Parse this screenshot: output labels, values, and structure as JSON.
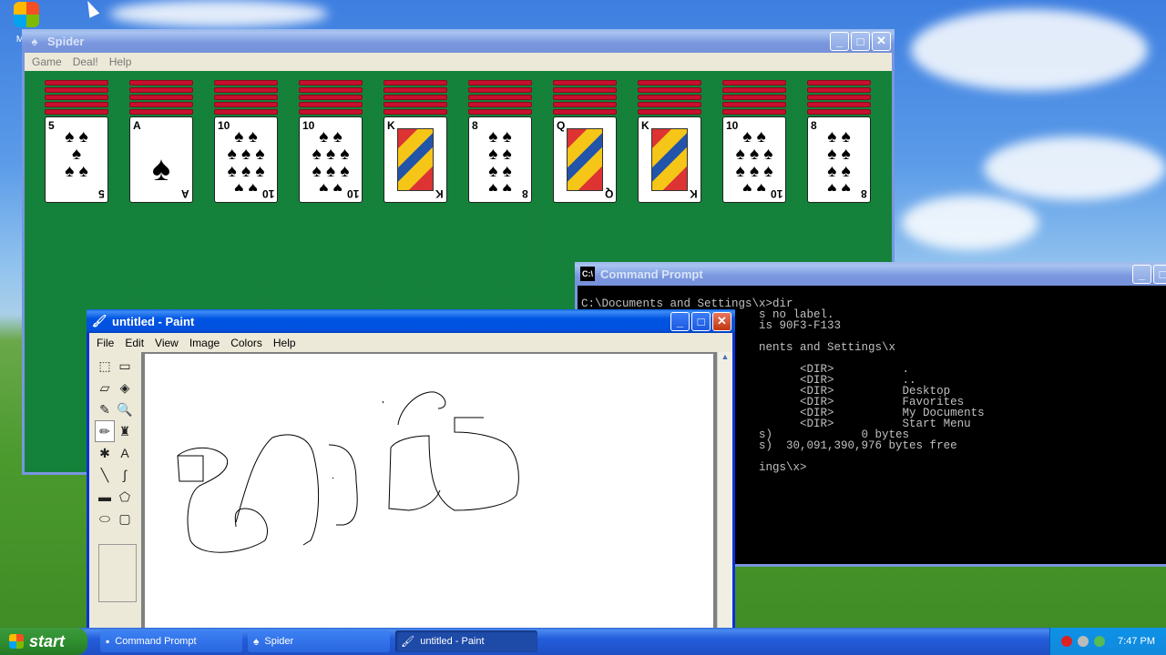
{
  "desktop": {
    "icon_label": "MSN"
  },
  "spider": {
    "title": "Spider",
    "menu": [
      "Game",
      "Deal!",
      "Help"
    ],
    "piles": [
      {
        "rank": "5",
        "pips": "♠ ♠\n♠\n♠ ♠",
        "face": false
      },
      {
        "rank": "A",
        "pips": "\n♠",
        "face": false
      },
      {
        "rank": "10",
        "pips": "♠ ♠\n♠ ♠ ♠\n♠ ♠ ♠\n♠ ♠",
        "face": false
      },
      {
        "rank": "10",
        "pips": "♠ ♠\n♠ ♠ ♠\n♠ ♠ ♠\n♠ ♠",
        "face": false
      },
      {
        "rank": "K",
        "pips": "",
        "face": true
      },
      {
        "rank": "8",
        "pips": "♠ ♠\n♠ ♠\n♠ ♠\n♠ ♠",
        "face": false
      },
      {
        "rank": "Q",
        "pips": "",
        "face": true
      },
      {
        "rank": "K",
        "pips": "",
        "face": true
      },
      {
        "rank": "10",
        "pips": "♠ ♠\n♠ ♠ ♠\n♠ ♠ ♠\n♠ ♠",
        "face": false
      },
      {
        "rank": "8",
        "pips": "♠ ♠\n♠ ♠\n♠ ♠\n♠ ♠",
        "face": false
      }
    ]
  },
  "cmd": {
    "title": "Command Prompt",
    "lines": [
      "C:\\Documents and Settings\\x>dir",
      "                          s no label.",
      "                          is 90F3-F133",
      "",
      "                          nents and Settings\\x",
      "",
      "                                <DIR>          .",
      "                                <DIR>          ..",
      "                                <DIR>          Desktop",
      "                                <DIR>          Favorites",
      "                                <DIR>          My Documents",
      "                                <DIR>          Start Menu",
      "                          s)             0 bytes",
      "                          s)  30,091,390,976 bytes free",
      "",
      "                          ings\\x>"
    ]
  },
  "paint": {
    "title": "untitled - Paint",
    "menu": [
      "File",
      "Edit",
      "View",
      "Image",
      "Colors",
      "Help"
    ],
    "tools": [
      {
        "name": "free-select-icon",
        "glyph": "⬚"
      },
      {
        "name": "select-icon",
        "glyph": "▭"
      },
      {
        "name": "eraser-icon",
        "glyph": "▱"
      },
      {
        "name": "fill-icon",
        "glyph": "◈"
      },
      {
        "name": "pick-color-icon",
        "glyph": "✎"
      },
      {
        "name": "magnifier-icon",
        "glyph": "🔍"
      },
      {
        "name": "pencil-icon",
        "glyph": "✏"
      },
      {
        "name": "brush-icon",
        "glyph": "♜"
      },
      {
        "name": "airbrush-icon",
        "glyph": "✱"
      },
      {
        "name": "text-icon",
        "glyph": "A"
      },
      {
        "name": "line-icon",
        "glyph": "╲"
      },
      {
        "name": "curve-icon",
        "glyph": "∫"
      },
      {
        "name": "rectangle-icon",
        "glyph": "▬"
      },
      {
        "name": "polygon-icon",
        "glyph": "⬠"
      },
      {
        "name": "ellipse-icon",
        "glyph": "⬭"
      },
      {
        "name": "rounded-rect-icon",
        "glyph": "▢"
      }
    ]
  },
  "taskbar": {
    "start": "start",
    "tasks": [
      {
        "label": "Command Prompt",
        "icon": "cmd-icon",
        "active": false
      },
      {
        "label": "Spider",
        "icon": "spider-icon",
        "active": false
      },
      {
        "label": "untitled - Paint",
        "icon": "paint-icon",
        "active": true
      }
    ],
    "clock": "7:47 PM"
  }
}
